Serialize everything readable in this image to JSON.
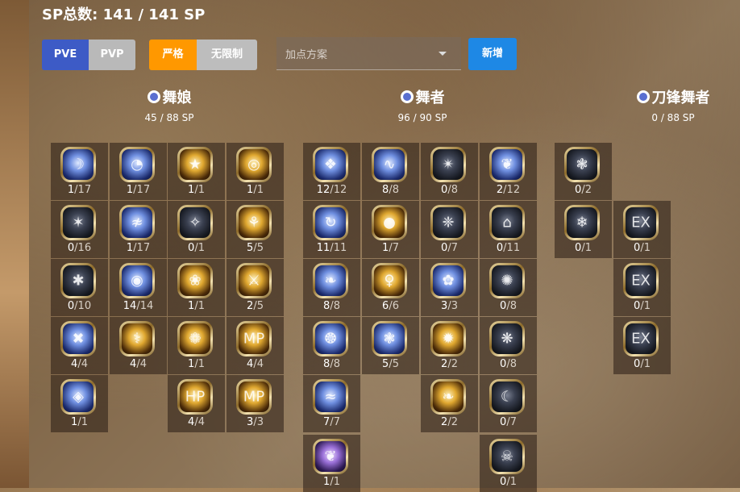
{
  "header": {
    "sp_total": "SP总数: 141 / 141 SP"
  },
  "mode_buttons": {
    "pve": "PVE",
    "pvp": "PVP"
  },
  "rule_buttons": {
    "strict": "严格",
    "free": "无限制"
  },
  "preset": {
    "placeholder": "加点方案"
  },
  "add_button": "新增",
  "trees": [
    {
      "name": "舞娘",
      "sp": "45 / 88 SP"
    },
    {
      "name": "舞者",
      "sp": "96 / 90 SP"
    },
    {
      "name": "刀锋舞者",
      "sp": "0 / 88 SP"
    }
  ],
  "skills": [
    {
      "cur": "1",
      "max": "/17",
      "style": "blue",
      "glyph": "☽"
    },
    {
      "cur": "1",
      "max": "/17",
      "style": "blue",
      "glyph": "◔"
    },
    {
      "cur": "1",
      "max": "/1",
      "style": "gold",
      "glyph": "★"
    },
    {
      "cur": "1",
      "max": "/1",
      "style": "gold",
      "glyph": "◎"
    },
    {
      "cur": "0",
      "max": "/16",
      "style": "dim",
      "glyph": "✶"
    },
    {
      "cur": "1",
      "max": "/17",
      "style": "blue",
      "glyph": "≉"
    },
    {
      "cur": "0",
      "max": "/1",
      "style": "dim",
      "glyph": "✧"
    },
    {
      "cur": "5",
      "max": "/5",
      "style": "gold",
      "glyph": "⚘"
    },
    {
      "cur": "0",
      "max": "/10",
      "style": "dim",
      "glyph": "✱"
    },
    {
      "cur": "14",
      "max": "/14",
      "style": "blue",
      "glyph": "◉"
    },
    {
      "cur": "1",
      "max": "/1",
      "style": "gold",
      "glyph": "❀"
    },
    {
      "cur": "2",
      "max": "/5",
      "style": "gold",
      "glyph": "⚔"
    },
    {
      "cur": "4",
      "max": "/4",
      "style": "blue",
      "glyph": "✖"
    },
    {
      "cur": "4",
      "max": "/4",
      "style": "gold",
      "glyph": "⚕"
    },
    {
      "cur": "1",
      "max": "/1",
      "style": "gold",
      "glyph": "❁"
    },
    {
      "cur": "4",
      "max": "/4",
      "style": "gold",
      "glyph": "MP"
    },
    {
      "cur": "1",
      "max": "/1",
      "style": "blue",
      "glyph": "◈"
    },
    {
      "cur": "4",
      "max": "/4",
      "style": "gold",
      "glyph": "HP"
    },
    {
      "cur": "3",
      "max": "/3",
      "style": "gold",
      "glyph": "MP"
    },
    {
      "cur": "12",
      "max": "/12",
      "style": "blue",
      "glyph": "❖"
    },
    {
      "cur": "8",
      "max": "/8",
      "style": "blue",
      "glyph": "∿"
    },
    {
      "cur": "0",
      "max": "/8",
      "style": "dim",
      "glyph": "✴"
    },
    {
      "cur": "2",
      "max": "/12",
      "style": "blue",
      "glyph": "❦"
    },
    {
      "cur": "11",
      "max": "/11",
      "style": "blue",
      "glyph": "↻"
    },
    {
      "cur": "1",
      "max": "/7",
      "style": "gold",
      "glyph": "●"
    },
    {
      "cur": "0",
      "max": "/7",
      "style": "dim",
      "glyph": "❈"
    },
    {
      "cur": "0",
      "max": "/11",
      "style": "dim",
      "glyph": "⌂"
    },
    {
      "cur": "8",
      "max": "/8",
      "style": "blue",
      "glyph": "❧"
    },
    {
      "cur": "6",
      "max": "/6",
      "style": "gold",
      "glyph": "♀"
    },
    {
      "cur": "3",
      "max": "/3",
      "style": "blue",
      "glyph": "✿"
    },
    {
      "cur": "0",
      "max": "/8",
      "style": "dim",
      "glyph": "✺"
    },
    {
      "cur": "8",
      "max": "/8",
      "style": "blue",
      "glyph": "❂"
    },
    {
      "cur": "5",
      "max": "/5",
      "style": "blue",
      "glyph": "❃"
    },
    {
      "cur": "2",
      "max": "/2",
      "style": "gold",
      "glyph": "✹"
    },
    {
      "cur": "0",
      "max": "/8",
      "style": "dim",
      "glyph": "❋"
    },
    {
      "cur": "7",
      "max": "/7",
      "style": "blue",
      "glyph": "≈"
    },
    {
      "cur": "2",
      "max": "/2",
      "style": "gold",
      "glyph": "❧"
    },
    {
      "cur": "0",
      "max": "/7",
      "style": "dim",
      "glyph": "☾"
    },
    {
      "cur": "1",
      "max": "/1",
      "style": "purple",
      "glyph": "❦"
    },
    {
      "cur": "0",
      "max": "/1",
      "style": "dim",
      "glyph": "☠"
    },
    {
      "cur": "0",
      "max": "/2",
      "style": "dim",
      "glyph": "❃"
    },
    {
      "cur": "0",
      "max": "/1",
      "style": "dim",
      "glyph": "❄"
    },
    {
      "cur": "0",
      "max": "/1",
      "style": "dim",
      "glyph": "EX"
    },
    {
      "cur": "0",
      "max": "/1",
      "style": "dim",
      "glyph": "EX"
    },
    {
      "cur": "0",
      "max": "/1",
      "style": "dim",
      "glyph": "EX"
    }
  ]
}
